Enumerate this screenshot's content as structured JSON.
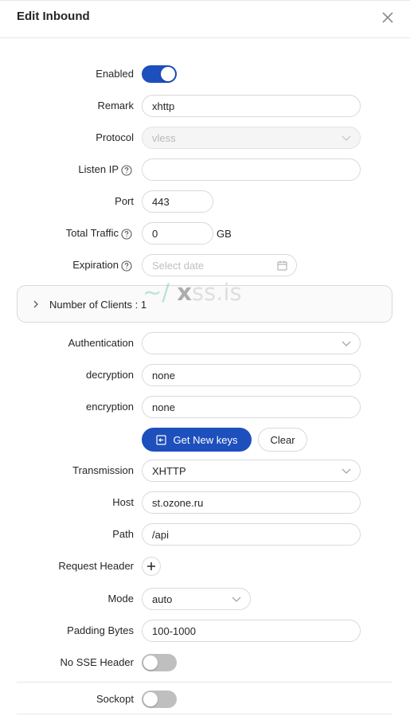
{
  "modal": {
    "title": "Edit Inbound"
  },
  "fields": {
    "enabled": {
      "label": "Enabled",
      "value": true
    },
    "remark": {
      "label": "Remark",
      "value": "xhttp"
    },
    "protocol": {
      "label": "Protocol",
      "value": "vless",
      "disabled": true
    },
    "listen_ip": {
      "label": "Listen IP",
      "value": ""
    },
    "port": {
      "label": "Port",
      "value": "443"
    },
    "total_traffic": {
      "label": "Total Traffic",
      "value": "0",
      "unit": "GB"
    },
    "expiration": {
      "label": "Expiration",
      "placeholder": "Select date"
    }
  },
  "clients": {
    "label": "Number of Clients : 1"
  },
  "watermark": {
    "prefix": "~/",
    "x": "x",
    "suffix": "ss.is"
  },
  "auth": {
    "authentication": {
      "label": "Authentication",
      "value": ""
    },
    "decryption": {
      "label": "decryption",
      "value": "none"
    },
    "encryption": {
      "label": "encryption",
      "value": "none"
    },
    "get_keys_label": "Get New keys",
    "clear_label": "Clear"
  },
  "transport": {
    "transmission": {
      "label": "Transmission",
      "value": "XHTTP"
    },
    "host": {
      "label": "Host",
      "value": "st.ozone.ru"
    },
    "path": {
      "label": "Path",
      "value": "/api"
    },
    "request_header": {
      "label": "Request Header"
    },
    "mode": {
      "label": "Mode",
      "value": "auto"
    },
    "padding_bytes": {
      "label": "Padding Bytes",
      "value": "100-1000"
    },
    "no_sse_header": {
      "label": "No SSE Header",
      "value": false
    }
  },
  "sockopt": {
    "label": "Sockopt",
    "value": false
  },
  "colors": {
    "primary": "#1d4fbd",
    "toggle_off": "#bfbfbf",
    "border": "#d9d9d9"
  },
  "icons": {
    "close": "close-icon",
    "help": "question-circle-icon",
    "chevron_down": "chevron-down-icon",
    "calendar": "calendar-icon",
    "chevron_right": "chevron-right-icon",
    "key": "key-export-icon",
    "plus": "plus-icon"
  }
}
